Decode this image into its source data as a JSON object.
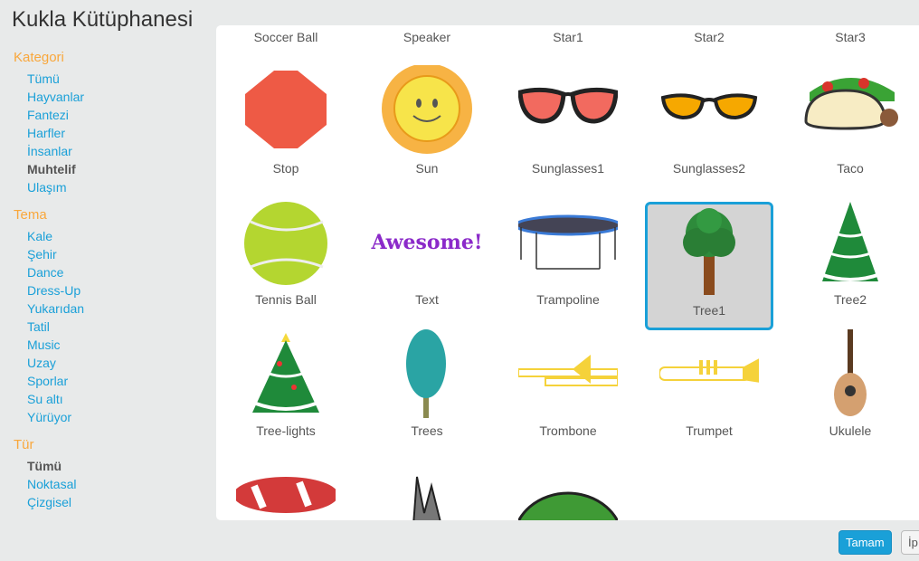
{
  "title": "Kukla Kütüphanesi",
  "sidebar": {
    "kategori": {
      "heading": "Kategori",
      "items": [
        "Tümü",
        "Hayvanlar",
        "Fantezi",
        "Harfler",
        "İnsanlar",
        "Muhtelif",
        "Ulaşım"
      ],
      "active": "Muhtelif"
    },
    "tema": {
      "heading": "Tema",
      "items": [
        "Kale",
        "Şehir",
        "Dance",
        "Dress-Up",
        "Yukarıdan",
        "Tatil",
        "Music",
        "Uzay",
        "Sporlar",
        "Su altı",
        "Yürüyor"
      ]
    },
    "tur": {
      "heading": "Tür",
      "items": [
        "Tümü",
        "Noktasal",
        "Çizgisel"
      ],
      "active": "Tümü"
    }
  },
  "sprites": {
    "row0": [
      "Soccer Ball",
      "Speaker",
      "Star1",
      "Star2",
      "Star3"
    ],
    "row1": [
      "Stop",
      "Sun",
      "Sunglasses1",
      "Sunglasses2",
      "Taco"
    ],
    "row2": [
      "Tennis Ball",
      "Text",
      "Trampoline",
      "Tree1",
      "Tree2"
    ],
    "row3": [
      "Tree-lights",
      "Trees",
      "Trombone",
      "Trumpet",
      "Ukulele"
    ],
    "selected": "Tree1",
    "text_sprite_content": "Awesome!"
  },
  "buttons": {
    "ok": "Tamam",
    "cancel": "İp"
  },
  "colors": {
    "accent": "#1aa0d8",
    "category_heading": "#f9a73b",
    "background": "#e8eaea"
  }
}
